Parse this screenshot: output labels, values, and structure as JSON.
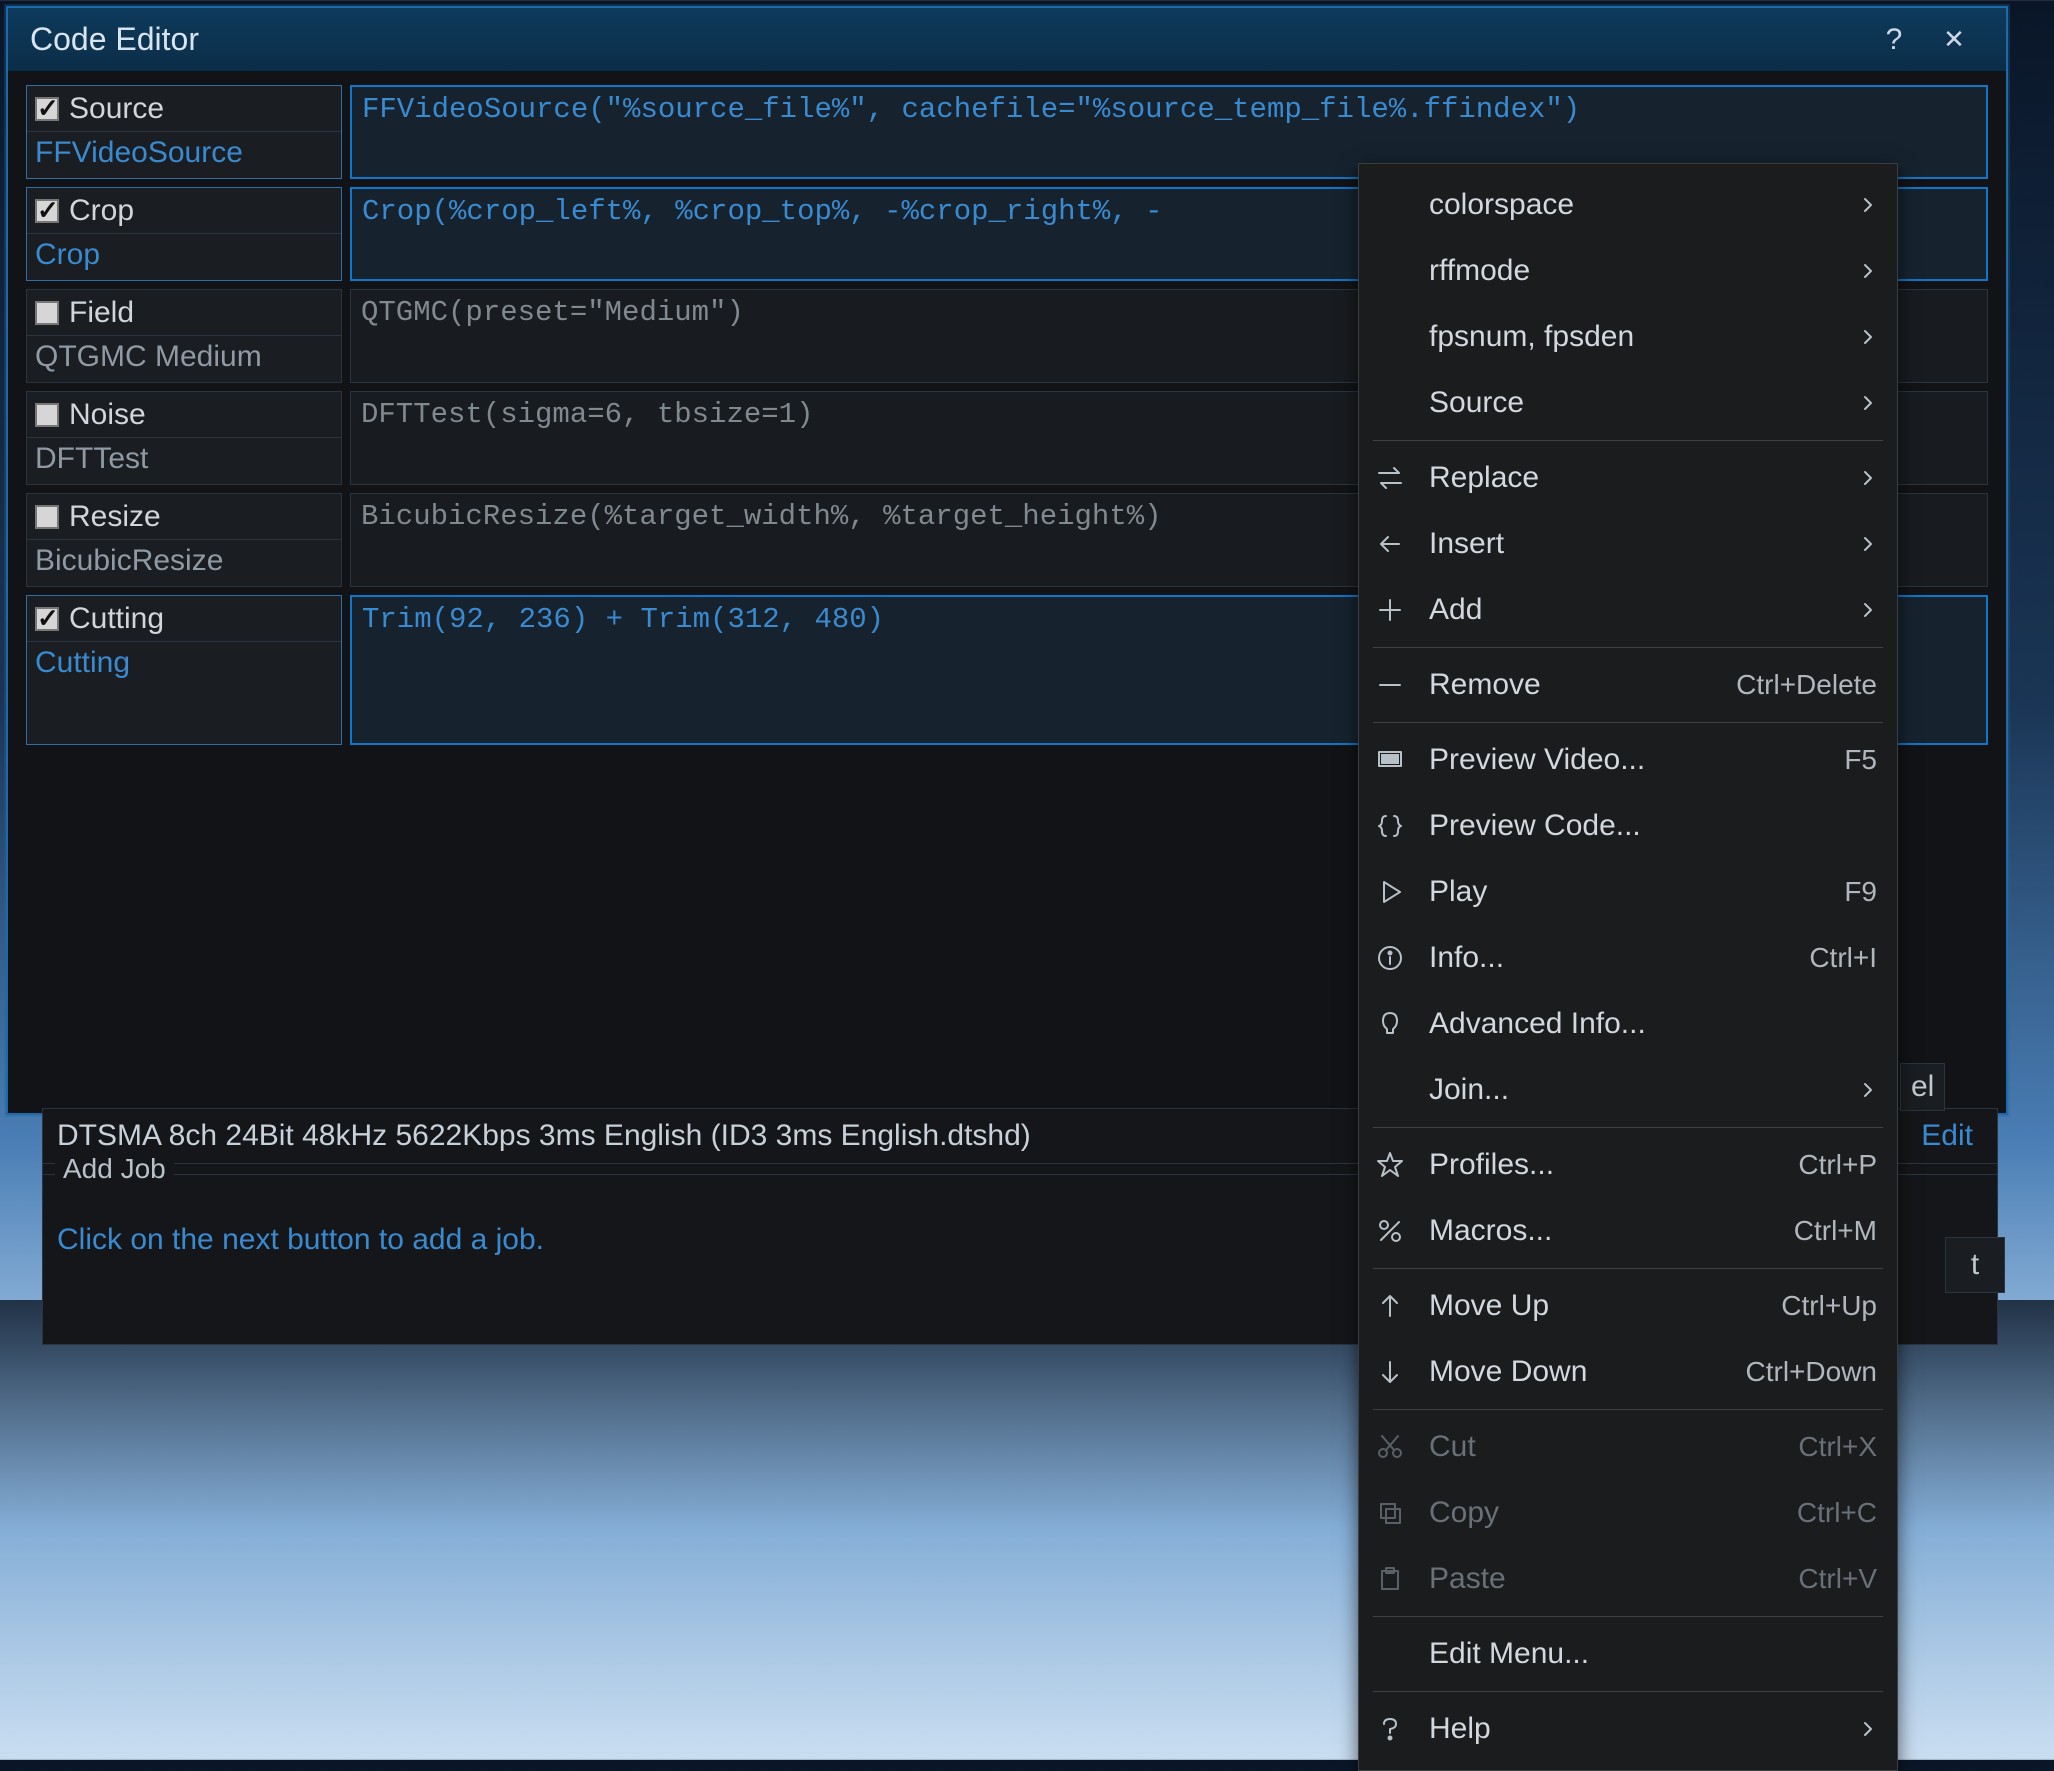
{
  "window": {
    "title": "Code Editor",
    "help_label": "?",
    "close_label": "✕"
  },
  "filters": [
    {
      "name": "Source",
      "sub": "FFVideoSource",
      "checked": true,
      "active": true,
      "code": "FFVideoSource(\"%source_file%\", cachefile=\"%source_temp_file%.ffindex\")"
    },
    {
      "name": "Crop",
      "sub": "Crop",
      "checked": true,
      "active": true,
      "code": "Crop(%crop_left%, %crop_top%, -%crop_right%, -"
    },
    {
      "name": "Field",
      "sub": "QTGMC Medium",
      "checked": false,
      "active": false,
      "code": "QTGMC(preset=\"Medium\")"
    },
    {
      "name": "Noise",
      "sub": "DFTTest",
      "checked": false,
      "active": false,
      "code": "DFTTest(sigma=6, tbsize=1)"
    },
    {
      "name": "Resize",
      "sub": "BicubicResize",
      "checked": false,
      "active": false,
      "code": "BicubicResize(%target_width%, %target_height%)"
    },
    {
      "name": "Cutting",
      "sub": "Cutting",
      "checked": true,
      "active": true,
      "code": "Trim(92, 236) + Trim(312, 480)"
    }
  ],
  "lower": {
    "audio_line": "DTSMA 8ch 24Bit 48kHz 5622Kbps 3ms English (ID3 3ms English.dtshd)",
    "edit_label": "Edit",
    "addjob_label": "Add Job",
    "addjob_msg": "Click on the next button to add a job.",
    "side_btn": "t",
    "el_fragment": "el"
  },
  "menu": {
    "items": [
      {
        "kind": "item",
        "label": "colorspace",
        "chevron": true
      },
      {
        "kind": "item",
        "label": "rffmode",
        "chevron": true
      },
      {
        "kind": "item",
        "label": "fpsnum, fpsden",
        "chevron": true
      },
      {
        "kind": "item",
        "label": "Source",
        "chevron": true
      },
      {
        "kind": "sep"
      },
      {
        "kind": "item",
        "icon": "swap",
        "label": "Replace",
        "chevron": true
      },
      {
        "kind": "item",
        "icon": "arrow-left",
        "label": "Insert",
        "chevron": true
      },
      {
        "kind": "item",
        "icon": "plus",
        "label": "Add",
        "chevron": true
      },
      {
        "kind": "sep"
      },
      {
        "kind": "item",
        "icon": "minus",
        "label": "Remove",
        "shortcut": "Ctrl+Delete"
      },
      {
        "kind": "sep"
      },
      {
        "kind": "item",
        "icon": "monitor",
        "label": "Preview Video...",
        "shortcut": "F5"
      },
      {
        "kind": "item",
        "icon": "braces",
        "label": "Preview Code..."
      },
      {
        "kind": "item",
        "icon": "play",
        "label": "Play",
        "shortcut": "F9"
      },
      {
        "kind": "item",
        "icon": "info",
        "label": "Info...",
        "shortcut": "Ctrl+I"
      },
      {
        "kind": "item",
        "icon": "bulb",
        "label": "Advanced Info..."
      },
      {
        "kind": "item",
        "label": "Join...",
        "chevron": true
      },
      {
        "kind": "sep"
      },
      {
        "kind": "item",
        "icon": "star",
        "label": "Profiles...",
        "shortcut": "Ctrl+P"
      },
      {
        "kind": "item",
        "icon": "percent",
        "label": "Macros...",
        "shortcut": "Ctrl+M"
      },
      {
        "kind": "sep"
      },
      {
        "kind": "item",
        "icon": "arrow-up",
        "label": "Move Up",
        "shortcut": "Ctrl+Up"
      },
      {
        "kind": "item",
        "icon": "arrow-down",
        "label": "Move Down",
        "shortcut": "Ctrl+Down"
      },
      {
        "kind": "sep"
      },
      {
        "kind": "item",
        "icon": "cut",
        "label": "Cut",
        "shortcut": "Ctrl+X",
        "disabled": true
      },
      {
        "kind": "item",
        "icon": "copy",
        "label": "Copy",
        "shortcut": "Ctrl+C",
        "disabled": true
      },
      {
        "kind": "item",
        "icon": "paste",
        "label": "Paste",
        "shortcut": "Ctrl+V",
        "disabled": true
      },
      {
        "kind": "sep"
      },
      {
        "kind": "item",
        "label": "Edit Menu..."
      },
      {
        "kind": "sep"
      },
      {
        "kind": "item",
        "icon": "help",
        "label": "Help",
        "chevron": true
      }
    ]
  }
}
